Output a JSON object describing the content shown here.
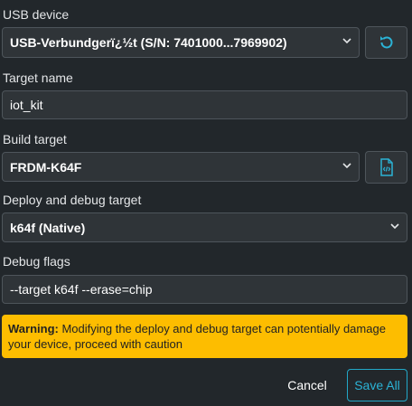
{
  "usb": {
    "label": "USB device",
    "selected": "USB-Verbundgerï¿½t (S/N: 7401000...7969902)",
    "refresh_icon": "refresh-icon"
  },
  "target_name": {
    "label": "Target name",
    "value": "iot_kit"
  },
  "build_target": {
    "label": "Build target",
    "selected": "FRDM-K64F",
    "file_icon": "file-code-icon"
  },
  "deploy": {
    "label": "Deploy and debug target",
    "selected": "k64f (Native)"
  },
  "debug_flags": {
    "label": "Debug flags",
    "value": "--target k64f --erase=chip"
  },
  "warning": {
    "title": "Warning:",
    "text": " Modifying the deploy and debug target can potentially damage your device, proceed with caution"
  },
  "actions": {
    "cancel": "Cancel",
    "save": "Save All"
  },
  "colors": {
    "background": "#22272b",
    "accent": "#2bb3d6",
    "warning": "#fdbd00"
  }
}
